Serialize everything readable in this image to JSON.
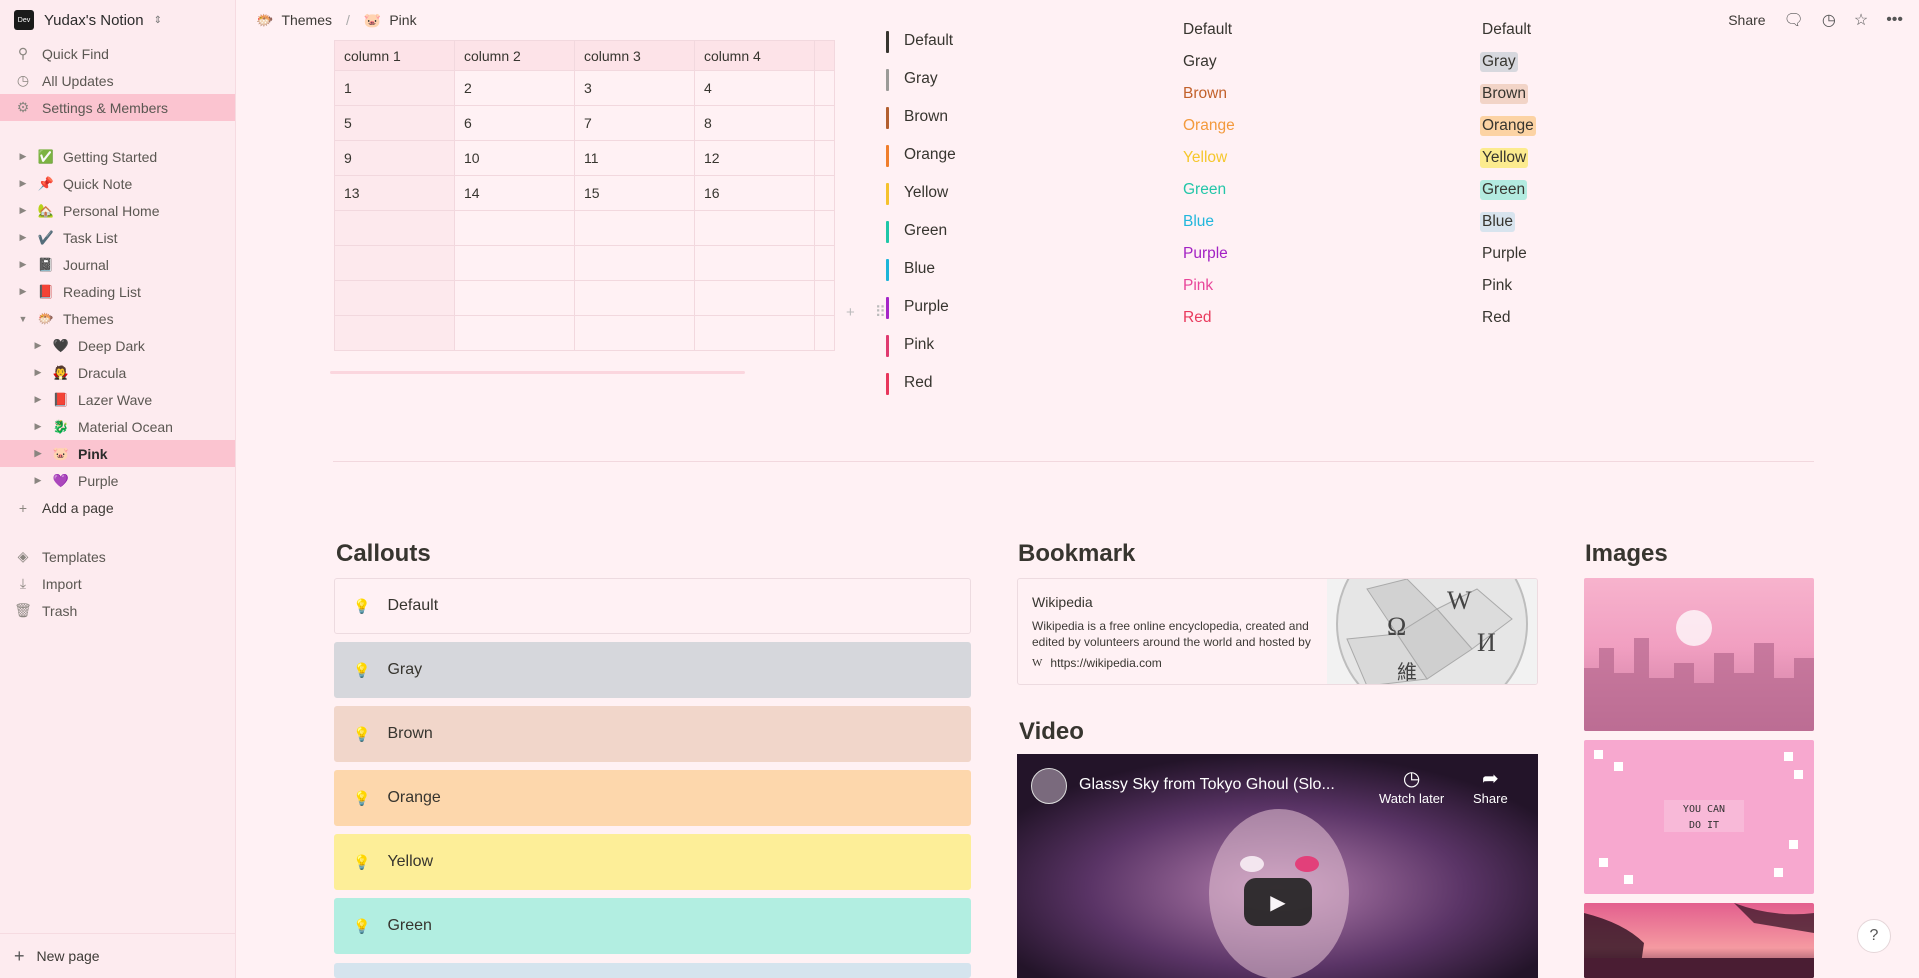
{
  "workspace": {
    "logo": "Dev",
    "name": "Yudax's Notion"
  },
  "nav": [
    {
      "icon": "search-icon",
      "label": "Quick Find"
    },
    {
      "icon": "clock-icon",
      "label": "All Updates"
    },
    {
      "icon": "gear-icon",
      "label": "Settings & Members"
    }
  ],
  "pages": [
    {
      "emoji": "✅",
      "label": "Getting Started"
    },
    {
      "emoji": "📌",
      "label": "Quick Note"
    },
    {
      "emoji": "🏡",
      "label": "Personal Home"
    },
    {
      "emoji": "✔️",
      "label": "Task List"
    },
    {
      "emoji": "📓",
      "label": "Journal"
    },
    {
      "emoji": "📕",
      "label": "Reading List"
    },
    {
      "emoji": "🐡",
      "label": "Themes"
    }
  ],
  "theme_pages": [
    {
      "emoji": "🖤",
      "label": "Deep Dark"
    },
    {
      "emoji": "🧛",
      "label": "Dracula"
    },
    {
      "emoji": "📕",
      "label": "Lazer Wave"
    },
    {
      "emoji": "🐉",
      "label": "Material Ocean"
    },
    {
      "emoji": "🐷",
      "label": "Pink"
    },
    {
      "emoji": "💜",
      "label": "Purple"
    }
  ],
  "add_page": "Add a page",
  "utilities": [
    {
      "icon": "templates-icon",
      "label": "Templates"
    },
    {
      "icon": "import-icon",
      "label": "Import"
    },
    {
      "icon": "trash-icon",
      "label": "Trash"
    }
  ],
  "new_page": "New page",
  "breadcrumb": [
    {
      "emoji": "🐡",
      "label": "Themes"
    },
    {
      "emoji": "🐷",
      "label": "Pink"
    }
  ],
  "topbar": {
    "share": "Share"
  },
  "table": {
    "headers": [
      "column 1",
      "column 2",
      "column 3",
      "column 4"
    ],
    "rows": [
      [
        "1",
        "2",
        "3",
        "4"
      ],
      [
        "5",
        "6",
        "7",
        "8"
      ],
      [
        "9",
        "10",
        "11",
        "12"
      ],
      [
        "13",
        "14",
        "15",
        "16"
      ],
      [
        "",
        "",
        "",
        ""
      ],
      [
        "",
        "",
        "",
        ""
      ],
      [
        "",
        "",
        "",
        ""
      ],
      [
        "",
        "",
        "",
        ""
      ]
    ]
  },
  "quote_colors": [
    {
      "label": "Default",
      "color": "#37352f"
    },
    {
      "label": "Gray",
      "color": "#9b9a97"
    },
    {
      "label": "Brown",
      "color": "#b35f2f"
    },
    {
      "label": "Orange",
      "color": "#f07e2b"
    },
    {
      "label": "Yellow",
      "color": "#f5c22c"
    },
    {
      "label": "Green",
      "color": "#1fc7a8"
    },
    {
      "label": "Blue",
      "color": "#1cb5d9"
    },
    {
      "label": "Purple",
      "color": "#a626c8"
    },
    {
      "label": "Pink",
      "color": "#e03a6f"
    },
    {
      "label": "Red",
      "color": "#e8365b"
    }
  ],
  "text_colors": [
    {
      "label": "Default",
      "color": "#37352f"
    },
    {
      "label": "Gray",
      "color": "#37352f"
    },
    {
      "label": "Brown",
      "color": "#c2612b"
    },
    {
      "label": "Orange",
      "color": "#f39a3d"
    },
    {
      "label": "Yellow",
      "color": "#f5c72c"
    },
    {
      "label": "Green",
      "color": "#23c6a8"
    },
    {
      "label": "Blue",
      "color": "#22b7dc"
    },
    {
      "label": "Purple",
      "color": "#a322c4"
    },
    {
      "label": "Pink",
      "color": "#e8469a"
    },
    {
      "label": "Red",
      "color": "#e93a5d"
    }
  ],
  "bg_colors": [
    {
      "label": "Default",
      "bg": "transparent"
    },
    {
      "label": "Gray",
      "bg": "#d7d8de"
    },
    {
      "label": "Brown",
      "bg": "#f2d4c7"
    },
    {
      "label": "Orange",
      "bg": "#fcd3a4"
    },
    {
      "label": "Yellow",
      "bg": "#fceb8e"
    },
    {
      "label": "Green",
      "bg": "#b3ebe0"
    },
    {
      "label": "Blue",
      "bg": "#d8e4ee"
    },
    {
      "label": "Purple",
      "bg": "transparent"
    },
    {
      "label": "Pink",
      "bg": "transparent"
    },
    {
      "label": "Red",
      "bg": "transparent"
    }
  ],
  "sections": {
    "callouts": "Callouts",
    "bookmark": "Bookmark",
    "video": "Video",
    "images": "Images"
  },
  "callouts": [
    {
      "label": "Default",
      "bg": "#fff1f4",
      "border": "#eddbe0"
    },
    {
      "label": "Gray",
      "bg": "#d6d7dc",
      "border": "#d6d7dc"
    },
    {
      "label": "Brown",
      "bg": "#f1d6ca",
      "border": "#f1d6ca"
    },
    {
      "label": "Orange",
      "bg": "#fdd7ac",
      "border": "#fdd7ac"
    },
    {
      "label": "Yellow",
      "bg": "#fdee98",
      "border": "#fdee98"
    },
    {
      "label": "Green",
      "bg": "#b2eee1",
      "border": "#b2eee1"
    }
  ],
  "bookmark": {
    "title": "Wikipedia",
    "description": "Wikipedia is a free online encyclopedia, created and edited by volunteers around the world and hosted by",
    "url": "https://wikipedia.com"
  },
  "video": {
    "title": "Glassy Sky from Tokyo Ghoul (Slo...",
    "watch_later": "Watch later",
    "share": "Share"
  },
  "help": "?"
}
